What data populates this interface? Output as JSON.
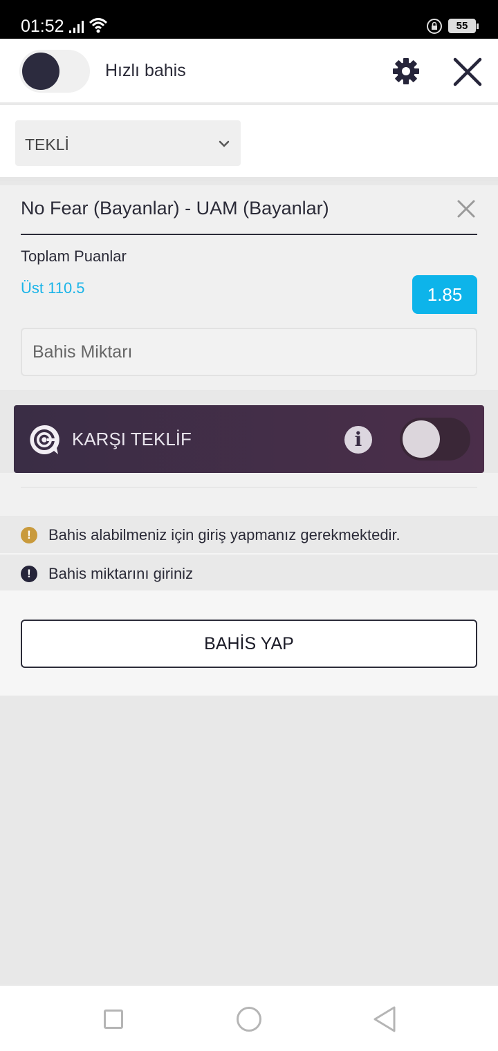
{
  "status_bar": {
    "time": "01:52",
    "battery": "55",
    "icons": [
      "signal-icon",
      "wifi-icon",
      "rotation-lock-icon",
      "battery-icon"
    ]
  },
  "header": {
    "quick_bet_label": "Hızlı bahis",
    "quick_bet_enabled": false,
    "icons": [
      "settings-gear-icon",
      "close-icon"
    ]
  },
  "bet_type": {
    "selected": "TEKLİ"
  },
  "bet": {
    "match": "No Fear (Bayanlar) - UAM (Bayanlar)",
    "market": "Toplam Puanlar",
    "selection": "Üst 110.5",
    "odds": "1.85",
    "stake_placeholder": "Bahis Miktarı"
  },
  "counter_offer": {
    "label": "KARŞI TEKLİF",
    "enabled": false
  },
  "warnings": [
    {
      "type": "warning",
      "text": "Bahis alabilmeniz için giriş yapmanız gerekmektedir."
    },
    {
      "type": "error",
      "text": "Bahis miktarını giriniz"
    }
  ],
  "place_bet_label": "BAHİS YAP",
  "colors": {
    "accent": "#0db4ea",
    "selection_text": "#1ab4e8",
    "dark": "#2b2b38",
    "counter_banner": "#3a2d45",
    "warning": "#c99a3c"
  }
}
